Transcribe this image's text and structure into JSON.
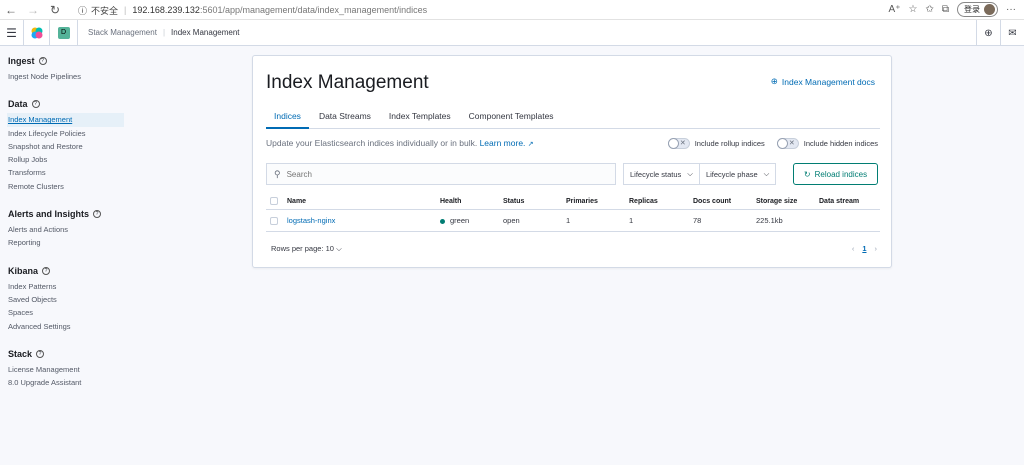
{
  "browser": {
    "insecure": "不安全",
    "url_host": "192.168.239.132",
    "url_path": ":5601/app/management/data/index_management/indices",
    "login_label": "登录"
  },
  "header": {
    "space_letter": "D",
    "breadcrumbs": [
      "Stack Management",
      "Index Management"
    ]
  },
  "sidebar": {
    "sections": [
      {
        "title": "Ingest",
        "items": [
          "Ingest Node Pipelines"
        ]
      },
      {
        "title": "Data",
        "items": [
          "Index Management",
          "Index Lifecycle Policies",
          "Snapshot and Restore",
          "Rollup Jobs",
          "Transforms",
          "Remote Clusters"
        ]
      },
      {
        "title": "Alerts and Insights",
        "items": [
          "Alerts and Actions",
          "Reporting"
        ]
      },
      {
        "title": "Kibana",
        "items": [
          "Index Patterns",
          "Saved Objects",
          "Spaces",
          "Advanced Settings"
        ]
      },
      {
        "title": "Stack",
        "items": [
          "License Management",
          "8.0 Upgrade Assistant"
        ]
      }
    ],
    "active_item": "Index Management"
  },
  "main": {
    "title": "Index Management",
    "docs_link": "Index Management docs",
    "tabs": [
      "Indices",
      "Data Streams",
      "Index Templates",
      "Component Templates"
    ],
    "active_tab": "Indices",
    "description": "Update your Elasticsearch indices individually or in bulk.",
    "learn_more": "Learn more.",
    "toggle_rollup": "Include rollup indices",
    "toggle_hidden": "Include hidden indices",
    "search_placeholder": "Search",
    "filter_lifecycle_status": "Lifecycle status",
    "filter_lifecycle_phase": "Lifecycle phase",
    "reload_label": "Reload indices",
    "table": {
      "columns": [
        "Name",
        "Health",
        "Status",
        "Primaries",
        "Replicas",
        "Docs count",
        "Storage size",
        "Data stream"
      ],
      "rows": [
        {
          "name": "logstash-nginx",
          "health": "green",
          "status": "open",
          "primaries": "1",
          "replicas": "1",
          "docs_count": "78",
          "storage_size": "225.1kb",
          "data_stream": ""
        }
      ]
    },
    "rows_per_page": "Rows per page: 10",
    "current_page": "1"
  },
  "colors": {
    "accent": "#006bb4",
    "success": "#017d73",
    "space_badge": "#54b399"
  }
}
